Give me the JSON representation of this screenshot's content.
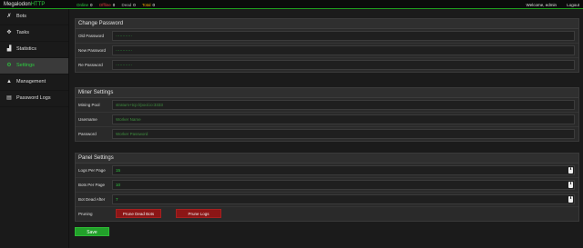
{
  "brand": {
    "name": "Megalodon",
    "accent": "HTTP"
  },
  "stats": [
    {
      "label": "Online",
      "value": "0"
    },
    {
      "label": "Offline",
      "value": "0"
    },
    {
      "label": "Dead",
      "value": "0"
    },
    {
      "label": "Total",
      "value": "0"
    }
  ],
  "header": {
    "welcome": "Welcome, edmin",
    "logout": "Logout"
  },
  "sidebar": {
    "items": [
      {
        "label": "Bots",
        "icon": "bots-icon"
      },
      {
        "label": "Tasks",
        "icon": "tasks-icon"
      },
      {
        "label": "Statistics",
        "icon": "statistics-icon"
      },
      {
        "label": "Settings",
        "icon": "settings-icon"
      },
      {
        "label": "Management",
        "icon": "management-icon"
      },
      {
        "label": "Password Logs",
        "icon": "password-logs-icon"
      }
    ],
    "active": "Settings"
  },
  "change_password": {
    "title": "Change Password",
    "old_label": "Old Password",
    "old_value": "············",
    "new_label": "New Password",
    "new_value": "············",
    "re_label": "Re Password",
    "re_value": "············"
  },
  "miner_settings": {
    "title": "Miner Settings",
    "pool_label": "Mining Pool",
    "pool_placeholder": "stratum+tcp://pool.io:3333",
    "username_label": "Username",
    "username_placeholder": "Worker Name",
    "password_label": "Password",
    "password_placeholder": "Worker Password"
  },
  "panel_settings": {
    "title": "Panel Settings",
    "logs_label": "Logs Per Page",
    "logs_value": "15",
    "bots_label": "Bots Per Page",
    "bots_value": "10",
    "dead_label": "Bot Dead After",
    "dead_value": "7",
    "pruning_label": "Pruning",
    "prune_bots": "Prune Dead Bots",
    "prune_logs": "Prune Logs"
  },
  "save_label": "Save",
  "colors": {
    "accent": "#2ecc40",
    "danger": "#8b1616",
    "background": "#1b1b1b"
  }
}
